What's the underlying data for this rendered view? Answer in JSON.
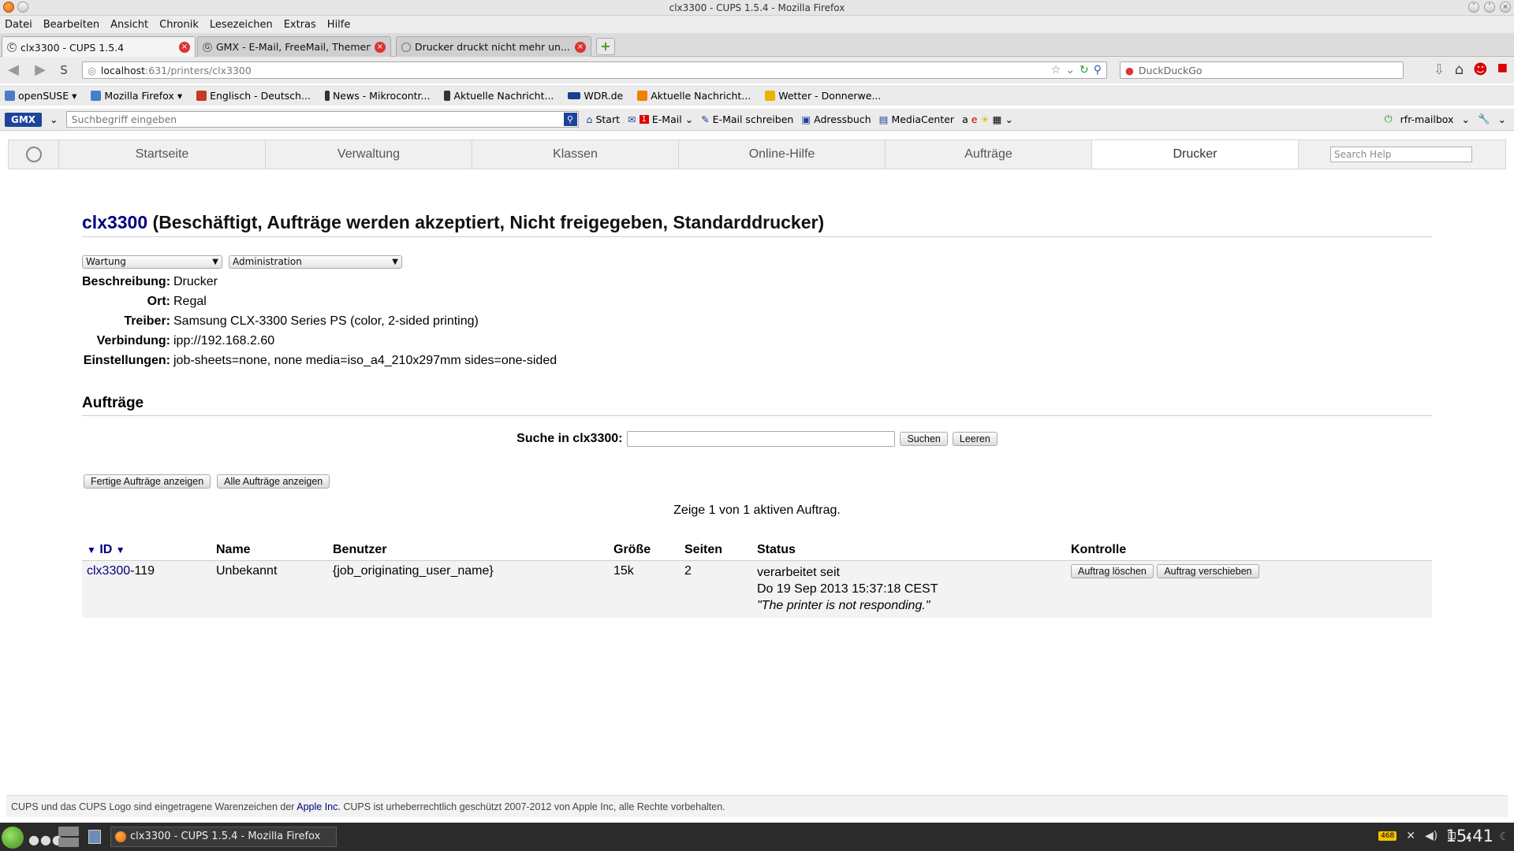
{
  "window": {
    "title": "clx3300 - CUPS 1.5.4 - Mozilla Firefox"
  },
  "menu": [
    "Datei",
    "Bearbeiten",
    "Ansicht",
    "Chronik",
    "Lesezeichen",
    "Extras",
    "Hilfe"
  ],
  "tabs": [
    {
      "label": "clx3300 - CUPS 1.5.4",
      "active": true
    },
    {
      "label": "GMX - E-Mail, FreeMail, Themen...",
      "active": false
    },
    {
      "label": "Drucker druckt nicht mehr un...",
      "active": false
    }
  ],
  "nav": {
    "url_host": "localhost",
    "url_path": ":631/printers/clx3300",
    "search_engine": "DuckDuckGo"
  },
  "bookmarks": [
    {
      "label": "openSUSE",
      "color": "#4a7cc9"
    },
    {
      "label": "Mozilla Firefox",
      "color": "#4a7cc9"
    },
    {
      "label": "Englisch - Deutsch...",
      "color": "#c23b22"
    },
    {
      "label": "News - Mikrocontr...",
      "color": "#333333"
    },
    {
      "label": "Aktuelle Nachricht...",
      "color": "#333333"
    },
    {
      "label": "WDR.de",
      "color": "#1a3f8f"
    },
    {
      "label": "Aktuelle Nachricht...",
      "color": "#f08000"
    },
    {
      "label": "Wetter - Donnerwe...",
      "color": "#e8b400"
    }
  ],
  "gmx": {
    "logo": "GMX",
    "search_placeholder": "Suchbegriff eingeben",
    "items": [
      "Start",
      "E-Mail",
      "E-Mail schreiben",
      "Adressbuch",
      "MediaCenter"
    ],
    "mail_count": "1",
    "account": "rfr-mailbox"
  },
  "cups": {
    "nav_tabs": [
      "Startseite",
      "Verwaltung",
      "Klassen",
      "Online-Hilfe",
      "Aufträge",
      "Drucker"
    ],
    "selected_tab": "Drucker",
    "help_placeholder": "Search Help",
    "printer_name": "clx3300",
    "printer_state": " (Beschäftigt, Aufträge werden akzeptiert, Nicht freigegeben, Standarddrucker)",
    "select_maintenance": "Wartung",
    "select_admin": "Administration",
    "details": [
      {
        "key": "Beschreibung:",
        "value": "Drucker"
      },
      {
        "key": "Ort:",
        "value": "Regal"
      },
      {
        "key": "Treiber:",
        "value": "Samsung CLX-3300 Series PS (color, 2-sided printing)"
      },
      {
        "key": "Verbindung:",
        "value": "ipp://192.168.2.60"
      },
      {
        "key": "Einstellungen:",
        "value": "job-sheets=none, none media=iso_a4_210x297mm sides=one-sided"
      }
    ],
    "jobs_heading": "Aufträge",
    "search_label": "Suche in clx3300:",
    "search_button": "Suchen",
    "clear_button": "Leeren",
    "show_completed": "Fertige Aufträge anzeigen",
    "show_all": "Alle Aufträge anzeigen",
    "showing_text": "Zeige 1 von 1 aktiven Auftrag.",
    "table_headers": {
      "id": "ID",
      "name": "Name",
      "user": "Benutzer",
      "size": "Größe",
      "pages": "Seiten",
      "status": "Status",
      "control": "Kontrolle"
    },
    "job": {
      "id_link": "clx3300",
      "id_suffix": "-119",
      "name": "Unbekannt",
      "user": "{job_originating_user_name}",
      "size": "15k",
      "pages": "2",
      "status_line1": "verarbeitet seit",
      "status_line2": "Do 19 Sep 2013 15:37:18 CEST",
      "status_msg": "\"The printer is not responding.\"",
      "cancel_button": "Auftrag löschen",
      "move_button": "Auftrag verschieben"
    },
    "footer_pre": "CUPS und das CUPS Logo sind eingetragene Warenzeichen der ",
    "footer_link": "Apple Inc.",
    "footer_post": " CUPS ist urheberrechtlich geschützt 2007-2012 von Apple Inc, alle Rechte vorbehalten."
  },
  "taskbar": {
    "task_label": "clx3300 - CUPS 1.5.4 - Mozilla Firefox",
    "battery": "468",
    "clock": "15:41"
  }
}
